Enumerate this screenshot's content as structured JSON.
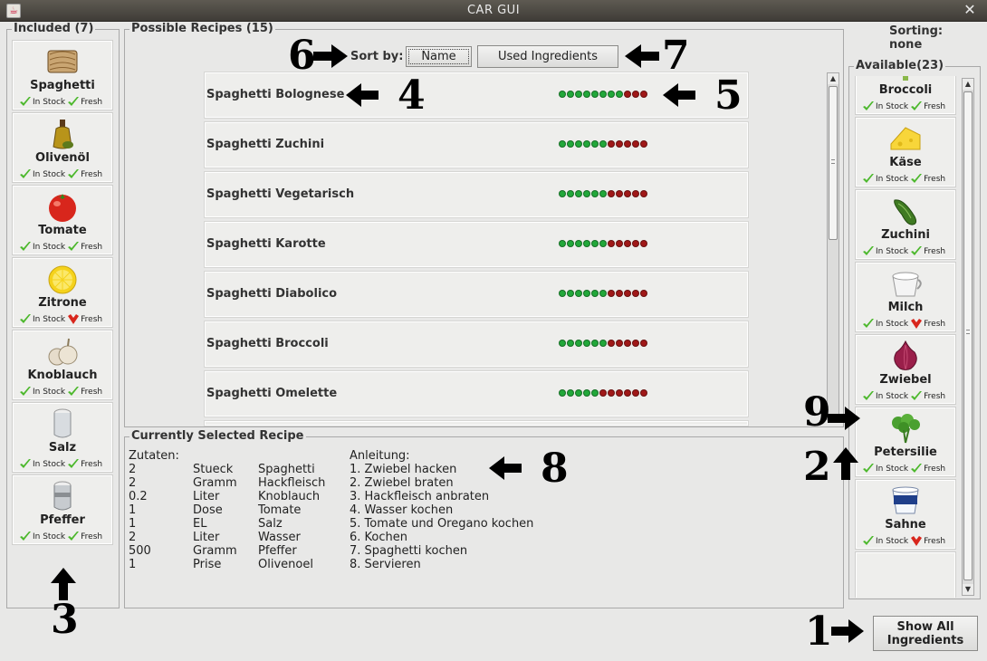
{
  "window": {
    "title": "CAR GUI",
    "close_glyph": "✕",
    "app_icon_glyph": "☕"
  },
  "included": {
    "title": "Included (7)",
    "items": [
      {
        "name": "Spaghetti",
        "icon": "spaghetti-icon",
        "in_stock": true,
        "fresh": true
      },
      {
        "name": "Olivenöl",
        "icon": "olive-oil-icon",
        "in_stock": true,
        "fresh": true
      },
      {
        "name": "Tomate",
        "icon": "tomato-icon",
        "in_stock": true,
        "fresh": true
      },
      {
        "name": "Zitrone",
        "icon": "lemon-icon",
        "in_stock": true,
        "fresh": false
      },
      {
        "name": "Knoblauch",
        "icon": "garlic-icon",
        "in_stock": true,
        "fresh": true
      },
      {
        "name": "Salz",
        "icon": "salt-shaker-icon",
        "in_stock": true,
        "fresh": true
      },
      {
        "name": "Pfeffer",
        "icon": "pepper-shaker-icon",
        "in_stock": true,
        "fresh": true
      }
    ]
  },
  "labels": {
    "in_stock": "In Stock",
    "fresh": "Fresh"
  },
  "recipes": {
    "title": "Possible Recipes (15)",
    "sort_label": "Sort by:",
    "sort_name": "Name",
    "sort_used": "Used Ingredients",
    "items": [
      {
        "name": "Spaghetti Bolognese",
        "green": 8,
        "red": 3
      },
      {
        "name": "Spaghetti Zuchini",
        "green": 6,
        "red": 5
      },
      {
        "name": "Spaghetti Vegetarisch",
        "green": 6,
        "red": 5
      },
      {
        "name": "Spaghetti Karotte",
        "green": 6,
        "red": 5
      },
      {
        "name": "Spaghetti Diabolico",
        "green": 6,
        "red": 5
      },
      {
        "name": "Spaghetti Broccoli",
        "green": 6,
        "red": 5
      },
      {
        "name": "Spaghetti Omelette",
        "green": 5,
        "red": 6
      }
    ]
  },
  "sorting": {
    "label": "Sorting:",
    "value": "none"
  },
  "available": {
    "title": "Available(23)",
    "items": [
      {
        "name": "Broccoli",
        "icon": "broccoli-icon",
        "in_stock": true,
        "fresh": true
      },
      {
        "name": "Käse",
        "icon": "cheese-icon",
        "in_stock": true,
        "fresh": true
      },
      {
        "name": "Zuchini",
        "icon": "zucchini-icon",
        "in_stock": true,
        "fresh": true
      },
      {
        "name": "Milch",
        "icon": "milk-cup-icon",
        "in_stock": true,
        "fresh": false
      },
      {
        "name": "Zwiebel",
        "icon": "onion-icon",
        "in_stock": true,
        "fresh": true
      },
      {
        "name": "Petersilie",
        "icon": "parsley-icon",
        "in_stock": true,
        "fresh": true
      },
      {
        "name": "Sahne",
        "icon": "cream-cup-icon",
        "in_stock": true,
        "fresh": false
      }
    ]
  },
  "selected": {
    "title": "Currently Selected Recipe",
    "zutaten_label": "Zutaten:",
    "anleitung_label": "Anleitung:",
    "ingredients": [
      {
        "qty": "2",
        "unit": "Stueck",
        "name": "Spaghetti"
      },
      {
        "qty": "2",
        "unit": "Gramm",
        "name": "Hackfleisch"
      },
      {
        "qty": "0.2",
        "unit": "Liter",
        "name": "Knoblauch"
      },
      {
        "qty": "1",
        "unit": "Dose",
        "name": "Tomate"
      },
      {
        "qty": "1",
        "unit": "EL",
        "name": "Salz"
      },
      {
        "qty": "2",
        "unit": "Liter",
        "name": "Wasser"
      },
      {
        "qty": "500",
        "unit": "Gramm",
        "name": "Pfeffer"
      },
      {
        "qty": "1",
        "unit": "Prise",
        "name": "Olivenoel"
      }
    ],
    "steps": [
      "1. Zwiebel hacken",
      "2. Zwiebel braten",
      "3. Hackfleisch anbraten",
      "4. Wasser kochen",
      "5. Tomate und Oregano kochen",
      "6. Kochen",
      "7. Spaghetti kochen",
      "8. Servieren"
    ]
  },
  "show_all_button": {
    "line1": "Show All",
    "line2": "Ingredients"
  },
  "annotations": [
    "1",
    "2",
    "3",
    "4",
    "5",
    "6",
    "7",
    "8",
    "9"
  ],
  "colors": {
    "dot_green": "#22a83a",
    "dot_red": "#a01818",
    "tick_green": "#4cb82c",
    "tick_red": "#d8261c"
  }
}
